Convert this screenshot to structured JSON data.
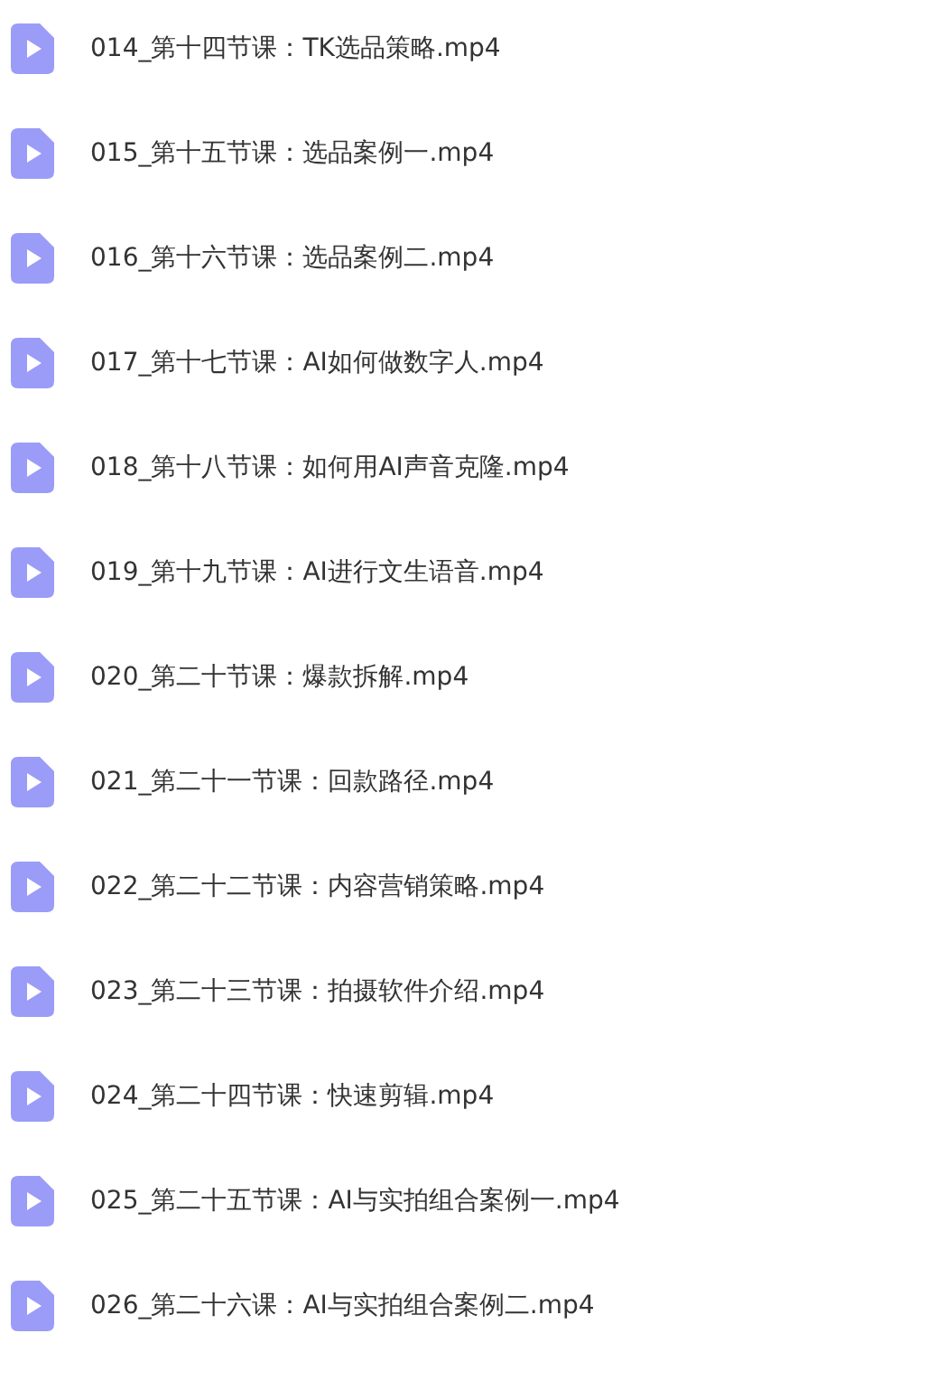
{
  "files": [
    {
      "name": "014_第十四节课：TK选品策略.mp4"
    },
    {
      "name": "015_第十五节课：选品案例一.mp4"
    },
    {
      "name": "016_第十六节课：选品案例二.mp4"
    },
    {
      "name": "017_第十七节课：AI如何做数字人.mp4"
    },
    {
      "name": "018_第十八节课：如何用AI声音克隆.mp4"
    },
    {
      "name": "019_第十九节课：AI进行文生语音.mp4"
    },
    {
      "name": "020_第二十节课：爆款拆解.mp4"
    },
    {
      "name": "021_第二十一节课：回款路径.mp4"
    },
    {
      "name": "022_第二十二节课：内容营销策略.mp4"
    },
    {
      "name": "023_第二十三节课：拍摄软件介绍.mp4"
    },
    {
      "name": "024_第二十四节课：快速剪辑.mp4"
    },
    {
      "name": "025_第二十五节课：AI与实拍组合案例一.mp4"
    },
    {
      "name": "026_第二十六课：AI与实拍组合案例二.mp4"
    }
  ]
}
